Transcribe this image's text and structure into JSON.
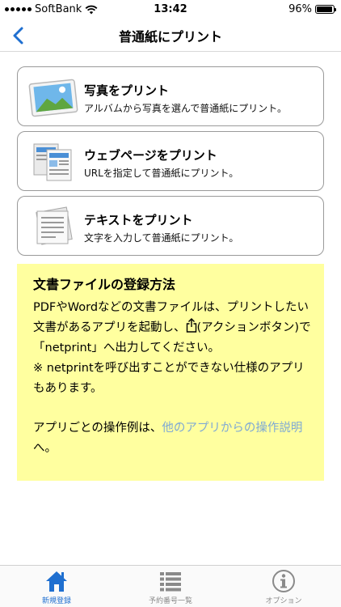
{
  "status": {
    "carrier": "SoftBank",
    "time": "13:42",
    "battery": "96%",
    "battery_level": 0.96
  },
  "nav": {
    "title": "普通紙にプリント",
    "back_icon": "chevron-left-icon"
  },
  "menu": [
    {
      "title": "写真をプリント",
      "desc": "アルバムから写真を選んで普通紙にプリント。",
      "icon": "photo-icon"
    },
    {
      "title": "ウェブページをプリント",
      "desc": "URLを指定して普通紙にプリント。",
      "icon": "webpage-icon"
    },
    {
      "title": "テキストをプリント",
      "desc": "文字を入力して普通紙にプリント。",
      "icon": "text-document-icon"
    }
  ],
  "info": {
    "heading": "文書ファイルの登録方法",
    "line1": "PDFやWordなどの文書ファイルは、プリントしたい文書があるアプリを起動し、",
    "line2": "(アクションボタン)で「netprint」へ出力してください。",
    "note": "※ netprintを呼び出すことができない仕様のアプリもあります。",
    "footer_prefix": "アプリごとの操作例は、",
    "footer_link": "他のアプリからの操作説明",
    "footer_suffix": "へ。"
  },
  "tabs": [
    {
      "label": "新規登録",
      "icon": "home-icon",
      "active": true
    },
    {
      "label": "予約番号一覧",
      "icon": "list-icon",
      "active": false
    },
    {
      "label": "オプション",
      "icon": "info-icon",
      "active": false
    }
  ],
  "colors": {
    "accent": "#1f6fd0",
    "info_background": "#ffff9f",
    "link": "#7fa9d4"
  }
}
